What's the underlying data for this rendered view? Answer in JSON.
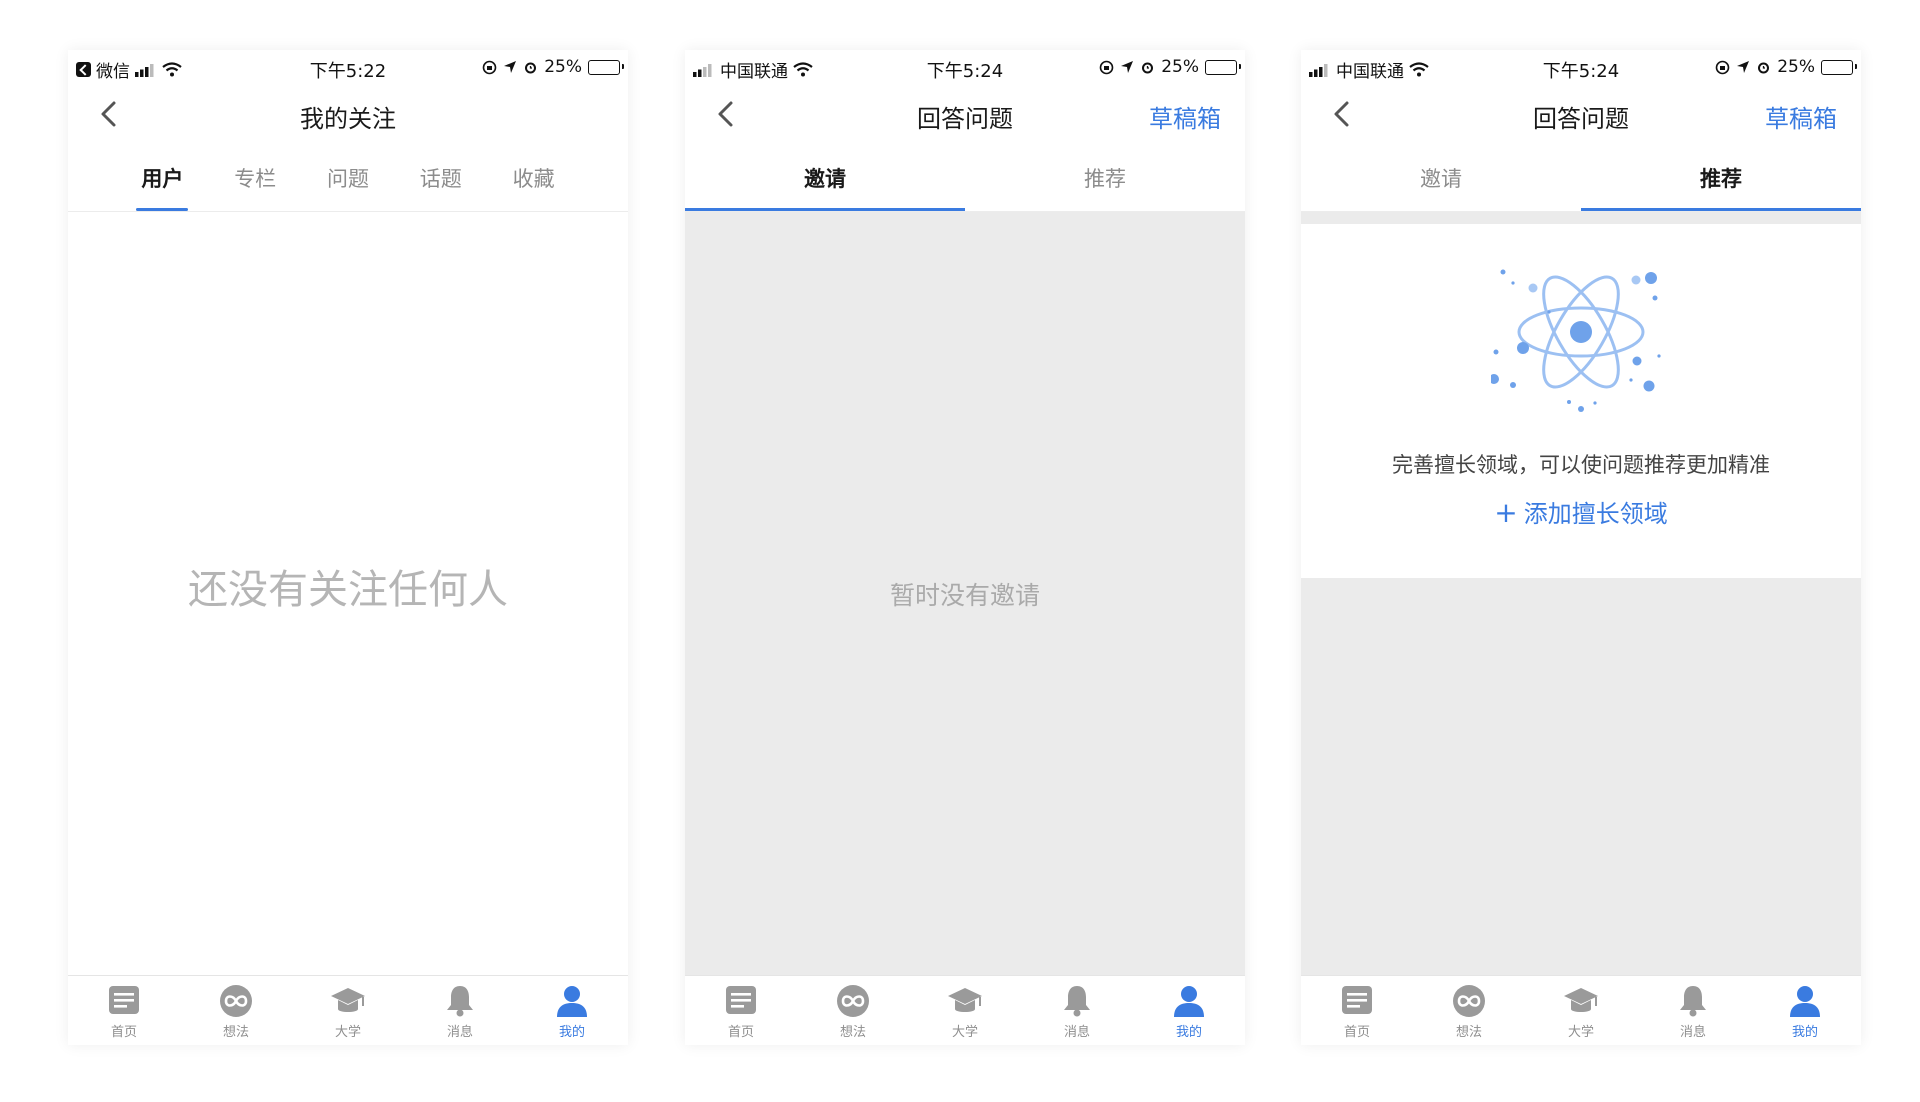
{
  "colors": {
    "accent": "#3a7be0",
    "inactive_icon": "#9a9a9a",
    "empty_bg": "#ebebeb",
    "illustration": "#7aa8ec"
  },
  "screens": [
    {
      "status_bar": {
        "left_app": "微信",
        "time": "下午5:22",
        "battery": "25%",
        "battery_level": 0.25,
        "icons": [
          "back-to-app-icon",
          "signal-icon",
          "wifi-icon",
          "lock-rotation-icon",
          "location-icon",
          "alarm-icon",
          "battery-icon"
        ]
      },
      "nav": {
        "title": "我的关注"
      },
      "tabs": [
        {
          "label": "用户",
          "active": true
        },
        {
          "label": "专栏",
          "active": false
        },
        {
          "label": "问题",
          "active": false
        },
        {
          "label": "话题",
          "active": false
        },
        {
          "label": "收藏",
          "active": false
        }
      ],
      "empty_text": "还没有关注任何人"
    },
    {
      "status_bar": {
        "carrier": "中国联通",
        "time": "下午5:24",
        "battery": "25%",
        "battery_level": 0.25,
        "icons": [
          "signal-icon",
          "wifi-icon",
          "lock-rotation-icon",
          "location-icon",
          "alarm-icon",
          "battery-icon"
        ]
      },
      "nav": {
        "title": "回答问题",
        "action": "草稿箱"
      },
      "tabs": [
        {
          "label": "邀请",
          "active": true
        },
        {
          "label": "推荐",
          "active": false
        }
      ],
      "empty_text": "暂时没有邀请"
    },
    {
      "status_bar": {
        "carrier": "中国联通",
        "time": "下午5:24",
        "battery": "25%",
        "battery_level": 0.25,
        "icons": [
          "signal-icon",
          "wifi-icon",
          "lock-rotation-icon",
          "location-icon",
          "alarm-icon",
          "battery-icon"
        ]
      },
      "nav": {
        "title": "回答问题",
        "action": "草稿箱"
      },
      "tabs": [
        {
          "label": "邀请",
          "active": false
        },
        {
          "label": "推荐",
          "active": true
        }
      ],
      "recommend": {
        "illustration": "atom-icon",
        "hint": "完善擅长领域，可以使问题推荐更加精准",
        "add_plus": "+",
        "add_label": "添加擅长领域"
      }
    }
  ],
  "tab_bar": {
    "items": [
      {
        "label": "首页",
        "icon": "home-feed-icon",
        "active": false
      },
      {
        "label": "想法",
        "icon": "infinity-icon",
        "active": false
      },
      {
        "label": "大学",
        "icon": "graduation-cap-icon",
        "active": false
      },
      {
        "label": "消息",
        "icon": "bell-icon",
        "active": false
      },
      {
        "label": "我的",
        "icon": "person-icon",
        "active": true
      }
    ]
  }
}
